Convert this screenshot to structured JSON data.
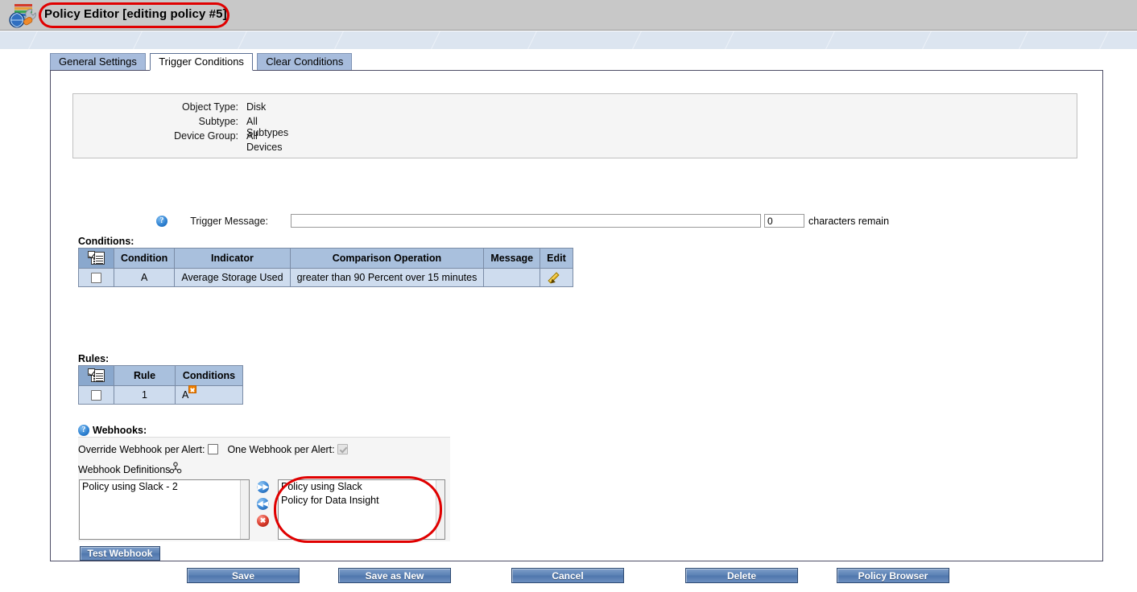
{
  "window": {
    "title": "Policy Editor [editing policy #5]",
    "app_icon": "policy-editor-icon",
    "title_highlight_color": "#e00000"
  },
  "tabs": [
    {
      "label": "General Settings",
      "active": false
    },
    {
      "label": "Trigger Conditions",
      "active": true
    },
    {
      "label": "Clear Conditions",
      "active": false
    }
  ],
  "summary": {
    "rows": [
      {
        "label": "Object Type:",
        "value": "Disk"
      },
      {
        "label": "Subtype:",
        "value": "All Subtypes"
      },
      {
        "label": "Device Group:",
        "value": "All Devices"
      }
    ],
    "trigger_message": {
      "help_icon": "help-icon",
      "label": "Trigger Message:",
      "value": "",
      "placeholder": "",
      "count_value": "0",
      "remain_label": "characters remain"
    }
  },
  "conditions": {
    "section_label": "Conditions:",
    "select_all_icon": "select-all-list-icon",
    "headers": [
      "Condition",
      "Indicator",
      "Comparison Operation",
      "Message",
      "Edit"
    ],
    "rows": [
      {
        "checked": false,
        "condition": "A",
        "indicator": "Average Storage Used",
        "comparison": "greater than 90 Percent over 15 minutes",
        "message": "",
        "edit_icon": "pencil-edit-icon"
      }
    ]
  },
  "rules": {
    "section_label": "Rules:",
    "select_all_icon": "select-all-list-icon",
    "headers": [
      "Rule",
      "Conditions"
    ],
    "rows": [
      {
        "checked": false,
        "rule": "1",
        "conditions": "A",
        "remove_badge": "x-remove-badge"
      }
    ]
  },
  "webhooks": {
    "help_icon": "help-icon",
    "title": "Webhooks:",
    "override_label": "Override Webhook per Alert:",
    "override_checked": false,
    "one_per_alert_label": "One Webhook per Alert:",
    "one_per_alert_checked": true,
    "one_per_alert_disabled": true,
    "definitions_label": "Webhook Definitions",
    "definitions_icon": "share-node-icon",
    "available_list": [
      "Policy using Slack - 2"
    ],
    "assigned_list": [
      "Policy using Slack",
      "Policy for Data Insight"
    ],
    "assigned_highlight_color": "#e00000",
    "buttons": {
      "add_icon": "double-arrow-right-icon",
      "remove_icon": "double-arrow-left-icon",
      "delete_icon": "red-x-delete-icon"
    },
    "test_button": "Test Webhook"
  },
  "footer": {
    "buttons": [
      {
        "label": "Save"
      },
      {
        "label": "Save as New"
      },
      {
        "label": "Cancel"
      },
      {
        "label": "Delete"
      },
      {
        "label": "Policy Browser"
      }
    ]
  }
}
